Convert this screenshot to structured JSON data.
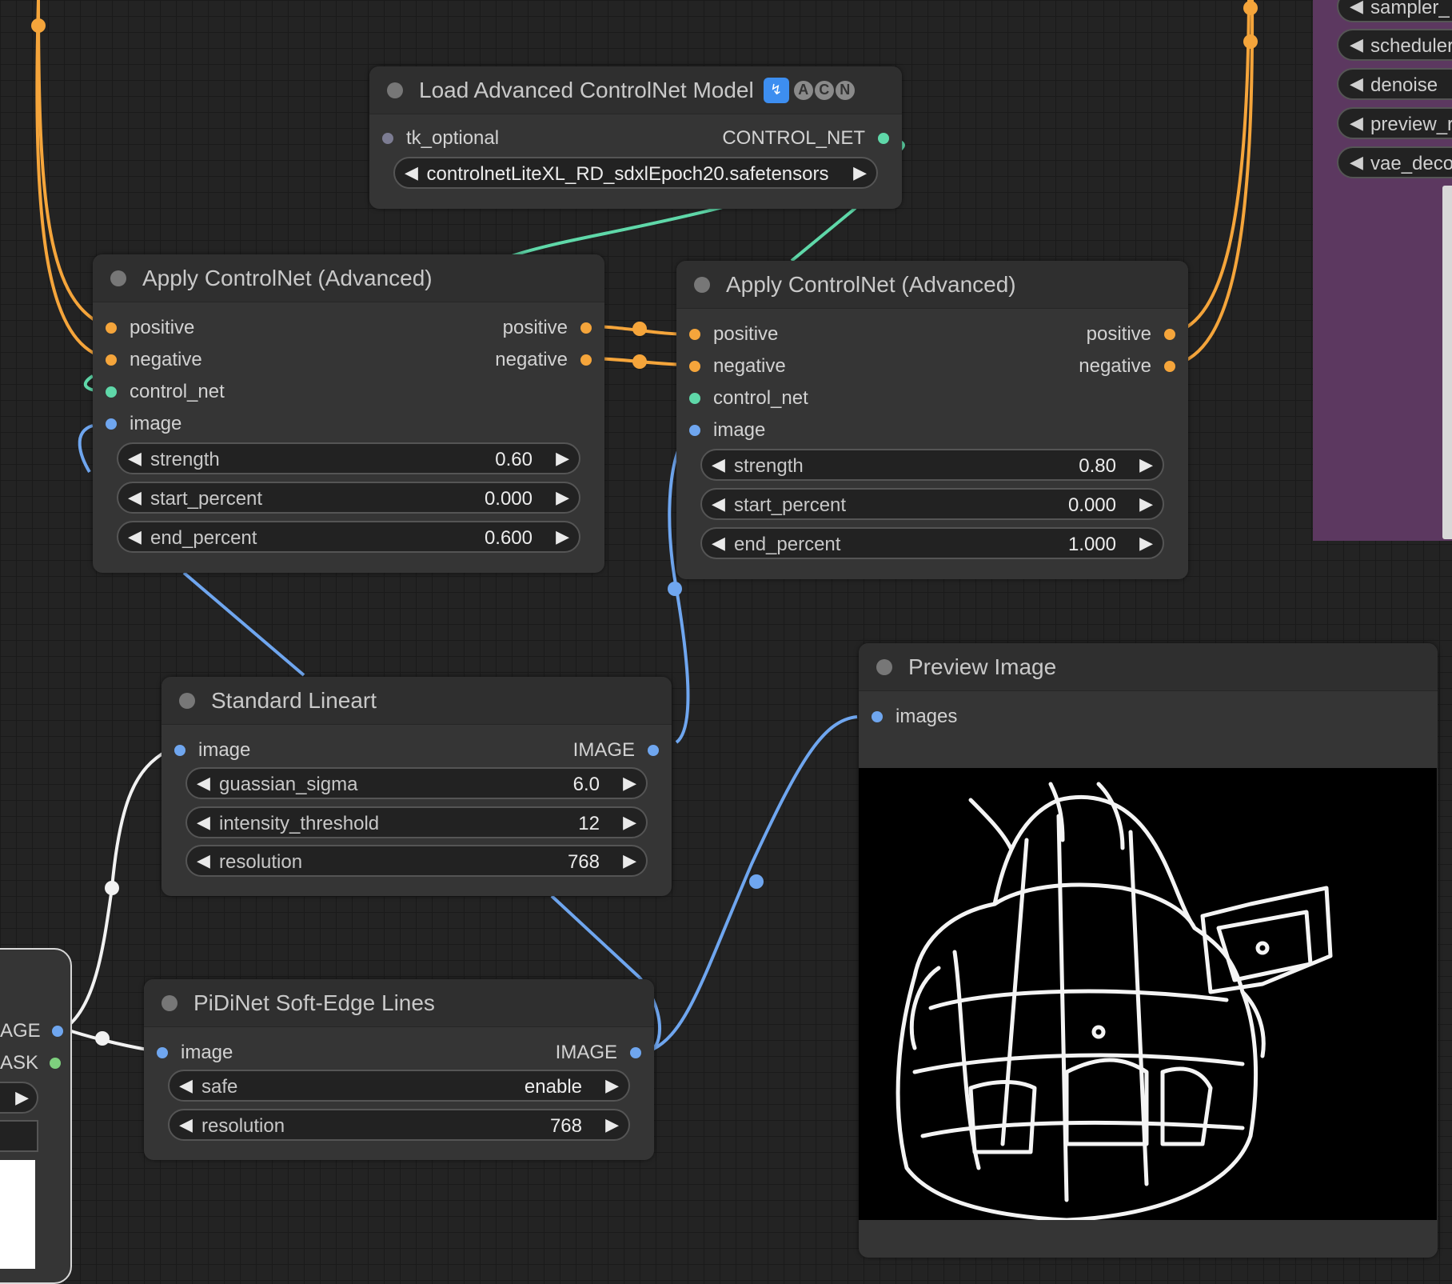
{
  "nodes": {
    "load_controlnet": {
      "title": "Load Advanced ControlNet Model",
      "badges": [
        "A",
        "C",
        "N"
      ],
      "input": "tk_optional",
      "output": "CONTROL_NET",
      "model_value": "controlnetLiteXL_RD_sdxlEpoch20.safetensors"
    },
    "apply_cn_1": {
      "title": "Apply ControlNet (Advanced)",
      "inputs": [
        "positive",
        "negative",
        "control_net",
        "image"
      ],
      "outputs": [
        "positive",
        "negative"
      ],
      "widgets": [
        {
          "name": "strength",
          "value": "0.60"
        },
        {
          "name": "start_percent",
          "value": "0.000"
        },
        {
          "name": "end_percent",
          "value": "0.600"
        }
      ]
    },
    "apply_cn_2": {
      "title": "Apply ControlNet (Advanced)",
      "inputs": [
        "positive",
        "negative",
        "control_net",
        "image"
      ],
      "outputs": [
        "positive",
        "negative"
      ],
      "widgets": [
        {
          "name": "strength",
          "value": "0.80"
        },
        {
          "name": "start_percent",
          "value": "0.000"
        },
        {
          "name": "end_percent",
          "value": "1.000"
        }
      ]
    },
    "standard_lineart": {
      "title": "Standard Lineart",
      "input": "image",
      "output": "IMAGE",
      "widgets": [
        {
          "name": "guassian_sigma",
          "value": "6.0"
        },
        {
          "name": "intensity_threshold",
          "value": "12"
        },
        {
          "name": "resolution",
          "value": "768"
        }
      ]
    },
    "pidinet": {
      "title": "PiDiNet Soft-Edge Lines",
      "input": "image",
      "output": "IMAGE",
      "widgets": [
        {
          "name": "safe",
          "value": "enable"
        },
        {
          "name": "resolution",
          "value": "768"
        }
      ]
    },
    "preview_image": {
      "title": "Preview Image",
      "input": "images"
    },
    "left_partial": {
      "outputs": [
        "AGE",
        "ASK"
      ]
    }
  },
  "right_panel": {
    "widgets": [
      "sampler_",
      "scheduler",
      "denoise",
      "preview_r",
      "vae_deco"
    ]
  },
  "colors": {
    "canvas_bg": "#232323",
    "node_bg": "#353535",
    "conditioning": "#f5a53b",
    "control_net": "#5fd8a9",
    "image": "#6fa6ef",
    "mask": "#7ed07e",
    "panel_purple": "#5c3860"
  }
}
